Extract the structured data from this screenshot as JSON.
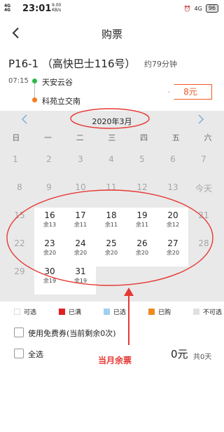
{
  "status_bar": {
    "signal": "4G\n4G",
    "time": "23:01",
    "speed": "9.00\nKB/s",
    "alarm": "⏰",
    "network": "4G",
    "battery": "96"
  },
  "header": {
    "title": "购票"
  },
  "route": {
    "name": "P16-1 （高快巴士116号）",
    "duration": "约79分钟",
    "departure_time": "07:15",
    "stops": [
      "天安云谷",
      "科苑立交南"
    ],
    "price": "8元"
  },
  "calendar": {
    "month": "2020年3月",
    "weekdays": [
      "日",
      "一",
      "二",
      "三",
      "四",
      "五",
      "六"
    ],
    "unavailable_before": [
      "1",
      "2",
      "3",
      "4",
      "5",
      "6",
      "7",
      "8",
      "9",
      "10",
      "11",
      "12",
      "13",
      "今天",
      "15",
      "22",
      "29"
    ],
    "available": [
      {
        "day": "16",
        "remain": "余13"
      },
      {
        "day": "17",
        "remain": "余11"
      },
      {
        "day": "18",
        "remain": "余11"
      },
      {
        "day": "19",
        "remain": "余11"
      },
      {
        "day": "20",
        "remain": "余12"
      },
      {
        "day": "21",
        "remain": ""
      },
      {
        "day": "23",
        "remain": "余20"
      },
      {
        "day": "24",
        "remain": "余20"
      },
      {
        "day": "25",
        "remain": "余20"
      },
      {
        "day": "26",
        "remain": "余20"
      },
      {
        "day": "27",
        "remain": "余20"
      },
      {
        "day": "28",
        "remain": ""
      },
      {
        "day": "30",
        "remain": "余19"
      },
      {
        "day": "31",
        "remain": "余19"
      }
    ]
  },
  "legend": [
    {
      "label": "可选",
      "color": "#ffffff"
    },
    {
      "label": "已满",
      "color": "#e02020"
    },
    {
      "label": "已选",
      "color": "#9fd0f0"
    },
    {
      "label": "已购",
      "color": "#f08a20"
    },
    {
      "label": "不可选",
      "color": "#e0e0e0"
    }
  ],
  "options": {
    "free_ticket": "使用免费券(当前剩余0次)",
    "select_all": "全选"
  },
  "total": {
    "amount": "0元",
    "count": "共0天"
  },
  "annotation": "当月余票",
  "colors": {
    "accent": "#f15a24",
    "annotation": "#e53935",
    "calendar_bg": "#e9e9e9"
  }
}
